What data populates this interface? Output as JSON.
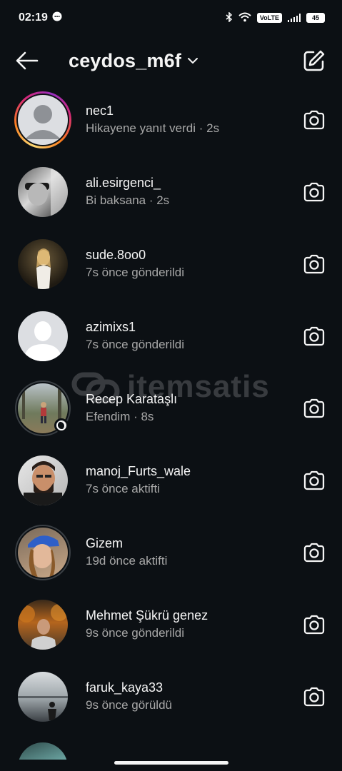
{
  "status_bar": {
    "time": "02:19",
    "volte": "VoLTE",
    "battery": "45"
  },
  "header": {
    "username": "ceydos_m6f"
  },
  "watermark": {
    "text": "itemsatis"
  },
  "conversations": [
    {
      "name": "nec1",
      "subtitle": "Hikayene yanıt verdi · 2s",
      "avatar": "default",
      "ring": "story"
    },
    {
      "name": "ali.esirgenci_",
      "subtitle": "Bi baksana · 2s",
      "avatar": "photo-gray",
      "ring": "none"
    },
    {
      "name": "sude.8oo0",
      "subtitle": "7s önce gönderildi",
      "avatar": "photo-dark-warm",
      "ring": "none"
    },
    {
      "name": "azimixs1",
      "subtitle": "7s önce gönderildi",
      "avatar": "default",
      "ring": "none"
    },
    {
      "name": "Recep Karataşlı",
      "subtitle": "Efendim · 8s",
      "avatar": "photo-outdoor",
      "ring": "seen",
      "badge": "moon"
    },
    {
      "name": "manoj_Furts_wale",
      "subtitle": "7s önce aktifti",
      "avatar": "photo-man-beard",
      "ring": "none"
    },
    {
      "name": "Gizem",
      "subtitle": "19d önce aktifti",
      "avatar": "photo-cap",
      "ring": "seen"
    },
    {
      "name": "Mehmet Şükrü genez",
      "subtitle": "9s önce gönderildi",
      "avatar": "photo-autumn",
      "ring": "none"
    },
    {
      "name": "faruk_kaya33",
      "subtitle": "9s önce görüldü",
      "avatar": "photo-lake",
      "ring": "none"
    }
  ],
  "icons": {
    "back": "arrow-left-icon",
    "dropdown": "chevron-down-icon",
    "compose": "compose-icon",
    "camera": "camera-icon"
  },
  "colors": {
    "background": "#0c1014",
    "primary_text": "#f5f5f5",
    "secondary_text": "#a8a8a8"
  }
}
